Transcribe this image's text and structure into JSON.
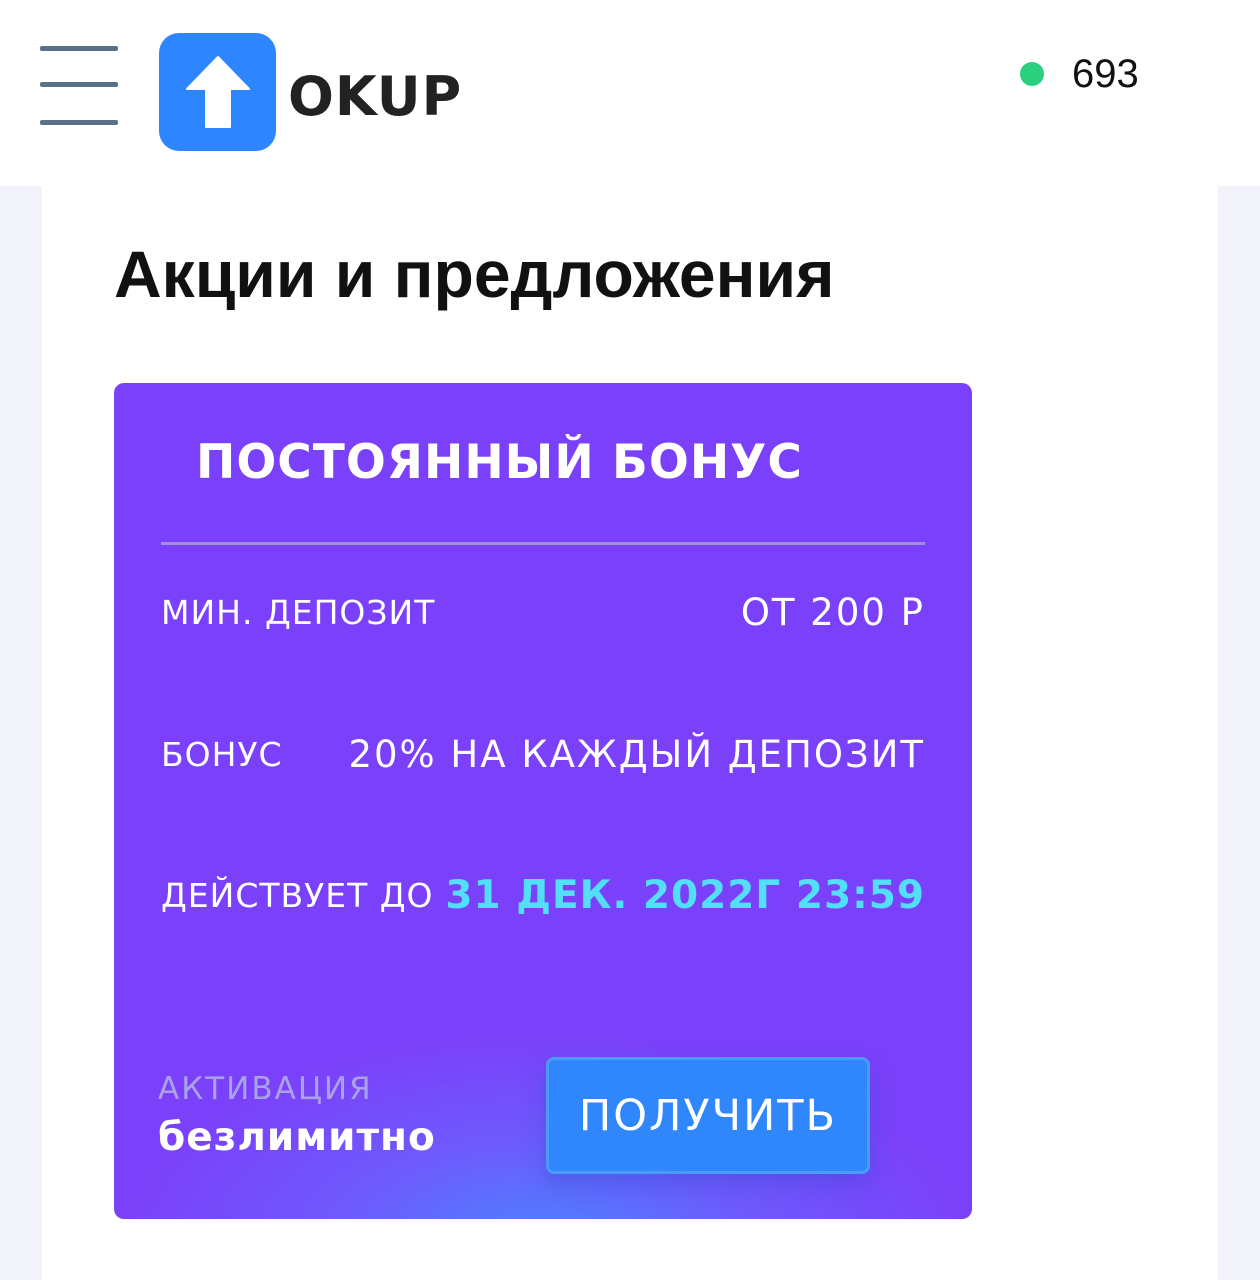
{
  "header": {
    "logo_text": "OKUP",
    "online_count": "693",
    "online_color": "#2ad07e",
    "brand_color": "#2d86ff"
  },
  "page": {
    "title": "Акции и предложения"
  },
  "promo_card": {
    "title": "ПОСТОЯННЫЙ БОНУС",
    "rows": [
      {
        "label": "МИН. ДЕПОЗИТ",
        "value": "ОТ 200 Р"
      },
      {
        "label": "БОНУС",
        "value": "20% НА КАЖДЫЙ ДЕПОЗИТ"
      },
      {
        "label": "ДЕЙСТВУЕТ ДО",
        "value": "31 ДЕК. 2022Г 23:59"
      }
    ],
    "activation_label": "АКТИВАЦИЯ",
    "activation_value": "безлимитно",
    "button_label": "ПОЛУЧИТЬ",
    "card_color": "#7b41fa",
    "accent_color": "#52dffa"
  },
  "icons": {
    "menu": "hamburger-menu-icon",
    "logo": "arrow-up-icon",
    "status": "online-dot-icon"
  }
}
